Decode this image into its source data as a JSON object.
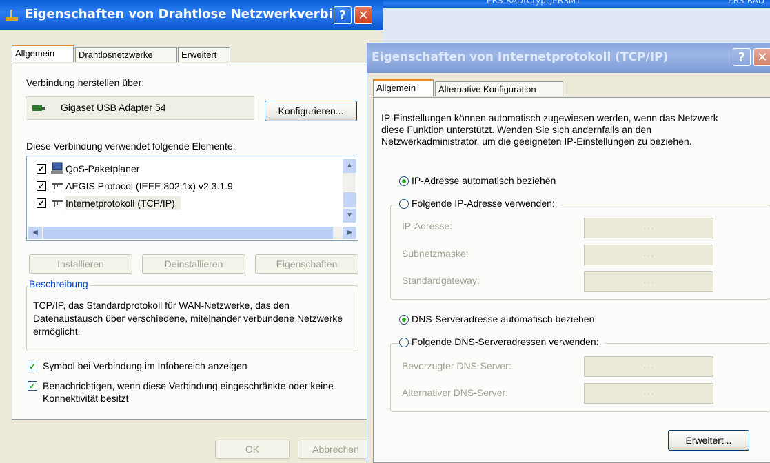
{
  "left_window": {
    "title": "Eigenschaften von Drahtlose Netzwerkverbi...",
    "tabs": [
      "Allgemein",
      "Drahtlosnetzwerke",
      "Erweitert"
    ],
    "connect_using_label": "Verbindung herstellen über:",
    "adapter_name": "Gigaset USB Adapter 54",
    "configure_button": "Konfigurieren...",
    "elements_label": "Diese Verbindung verwendet folgende Elemente:",
    "elements": [
      "QoS-Paketplaner",
      "AEGIS Protocol (IEEE 802.1x) v2.3.1.9",
      "Internetprotokoll (TCP/IP)"
    ],
    "install_button": "Installieren",
    "uninstall_button": "Deinstallieren",
    "properties_button": "Eigenschaften",
    "description_title": "Beschreibung",
    "description_text": "TCP/IP, das Standardprotokoll für WAN-Netzwerke, das den Datenaustausch über verschiedene, miteinander verbundene Netzwerke ermöglicht.",
    "show_icon_label": "Symbol bei Verbindung im Infobereich anzeigen",
    "notify_label": "Benachrichtigen, wenn diese Verbindung eingeschränkte oder keine Konnektivität besitzt",
    "ok_button": "OK",
    "cancel_button": "Abbrechen"
  },
  "right_window": {
    "background_title_left": "ERS-RAD(Crypt)ERSMT",
    "background_title_right": "ERS-RAD",
    "title": "Eigenschaften von Internetprotokoll (TCP/IP)",
    "tabs": [
      "Allgemein",
      "Alternative Konfiguration"
    ],
    "intro_text": "IP-Einstellungen können automatisch zugewiesen werden, wenn das Netzwerk diese Funktion unterstützt. Wenden Sie sich andernfalls an den Netzwerkadministrator, um die geeigneten IP-Einstellungen zu beziehen.",
    "auto_ip_label": "IP-Adresse automatisch beziehen",
    "manual_ip_label": "Folgende IP-Adresse verwenden:",
    "ip_address_label": "IP-Adresse:",
    "subnet_label": "Subnetzmaske:",
    "gateway_label": "Standardgateway:",
    "auto_dns_label": "DNS-Serveradresse automatisch beziehen",
    "manual_dns_label": "Folgende DNS-Serveradressen verwenden:",
    "preferred_dns_label": "Bevorzugter DNS-Server:",
    "alternate_dns_label": "Alternativer DNS-Server:",
    "advanced_button": "Erweitert...",
    "ip_placeholder": ".    .    ."
  },
  "help_glyph": "?",
  "close_glyph": "✕",
  "colors": {
    "title_active": "#0a5fd8",
    "window_bg": "#ece9d8",
    "tab_accent": "#e68b2c",
    "radio_dot": "#21a121"
  }
}
